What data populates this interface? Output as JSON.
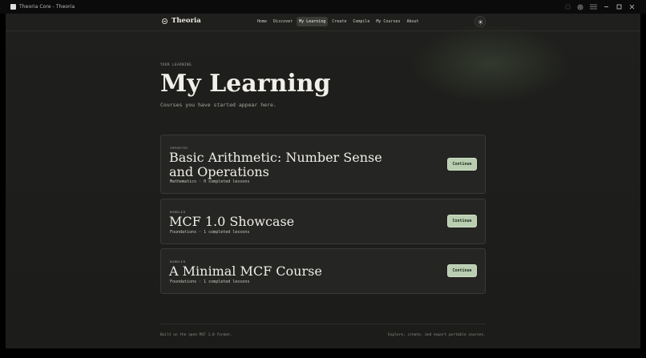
{
  "window": {
    "title": "Theoria Core - Theoria"
  },
  "header": {
    "brand": "Theoria",
    "nav": [
      {
        "label": "Home",
        "active": false
      },
      {
        "label": "Discover",
        "active": false
      },
      {
        "label": "My Learning",
        "active": true
      },
      {
        "label": "Create",
        "active": false
      },
      {
        "label": "Compile",
        "active": false
      },
      {
        "label": "My Courses",
        "active": false
      },
      {
        "label": "About",
        "active": false
      }
    ],
    "theme_toggle_icon": "sun-icon"
  },
  "hero": {
    "eyebrow": "YOUR LEARNING",
    "title": "My Learning",
    "subtitle": "Courses you have started appear here."
  },
  "courses": [
    {
      "tag": "IMPORTED",
      "title": "Basic Arithmetic: Number Sense and Operations",
      "meta": "Mathematics · 0 completed lessons",
      "button": "Continue"
    },
    {
      "tag": "BUNDLED",
      "title": "MCF 1.0 Showcase",
      "meta": "Foundations · 1 completed lessons",
      "button": "Continue"
    },
    {
      "tag": "BUNDLED",
      "title": "A Minimal MCF Course",
      "meta": "Foundations · 1 completed lessons",
      "button": "Continue"
    }
  ],
  "footer": {
    "left": "Built on the open MCF 1.0 format.",
    "right": "Explore, create, and export portable courses."
  },
  "colors": {
    "background": "#1e1e1c",
    "card": "#252523",
    "accent_button": "#b9cdb1",
    "active_nav": "#3a3a37"
  }
}
